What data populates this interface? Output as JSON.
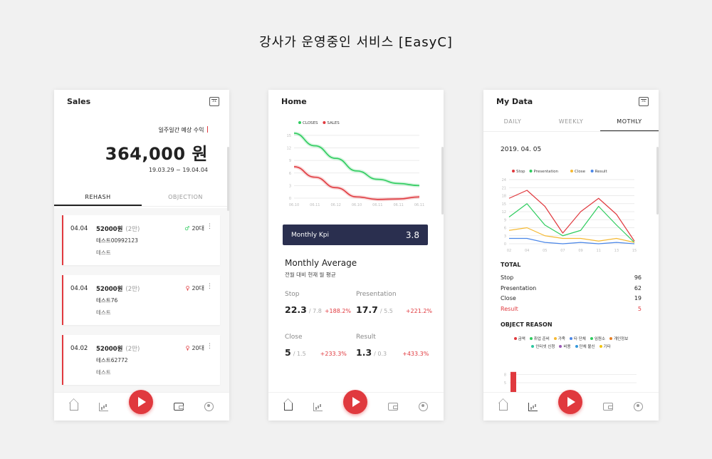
{
  "page_title": "강사가 운영중인 서비스 [EasyC]",
  "colors": {
    "accent": "#e0393e",
    "navy": "#2a2f4f",
    "green": "#2ecc5e"
  },
  "nav": {
    "icons": [
      "home-icon",
      "chart-icon",
      "play-icon",
      "wallet-icon",
      "user-icon"
    ]
  },
  "sales": {
    "title": "Sales",
    "calendar_num": "31",
    "label": "일주일간 예상 수익",
    "amount": "364,000 원",
    "range": "19.03.29 ~ 19.04.04",
    "tabs": [
      "REHASH",
      "OBJECTION"
    ],
    "cards": [
      {
        "date": "04.04",
        "amount": "52000원",
        "sub": "(2만)",
        "gender": "♂",
        "age": "20대",
        "id": "테스트00992123",
        "note": "테스트"
      },
      {
        "date": "04.04",
        "amount": "52000원",
        "sub": "(2만)",
        "gender": "♀",
        "age": "20대",
        "id": "테스트76",
        "note": "테스트"
      },
      {
        "date": "04.02",
        "amount": "52000원",
        "sub": "(2만)",
        "gender": "♀",
        "age": "20대",
        "id": "테스트62772",
        "note": "테스트"
      }
    ]
  },
  "home": {
    "title": "Home",
    "kpi_label": "Monthly Kpi",
    "kpi_value": "3.8",
    "avg_title": "Monthly Average",
    "avg_sub": "전월 대비 현재 월 평균",
    "stats": [
      {
        "label": "Stop",
        "value": "22.3",
        "prev": "/ 7.8",
        "change": "+188.2%"
      },
      {
        "label": "Presentation",
        "value": "17.7",
        "prev": "/ 5.5",
        "change": "+221.2%"
      },
      {
        "label": "Close",
        "value": "5",
        "prev": "/ 1.5",
        "change": "+233.3%"
      },
      {
        "label": "Result",
        "value": "1.3",
        "prev": "/ 0.3",
        "change": "+433.3%"
      }
    ]
  },
  "mydata": {
    "title": "My Data",
    "tabs": [
      "DAILY",
      "WEEKLY",
      "MOTHLY"
    ],
    "date": "2019. 04. 05",
    "total_title": "TOTAL",
    "totals": [
      {
        "label": "Stop",
        "value": "96"
      },
      {
        "label": "Presentation",
        "value": "62"
      },
      {
        "label": "Close",
        "value": "19"
      },
      {
        "label": "Result",
        "value": "5"
      }
    ],
    "reason_title": "OBJECT REASON",
    "reasons": [
      {
        "label": "금액",
        "color": "#e0393e"
      },
      {
        "label": "취업 준비",
        "color": "#2ecc5e"
      },
      {
        "label": "가족",
        "color": "#f5b933"
      },
      {
        "label": "타 단체",
        "color": "#4a86e8"
      },
      {
        "label": "임원소",
        "color": "#2ecc5e"
      },
      {
        "label": "개인정보",
        "color": "#e67e22"
      },
      {
        "label": "인터넷 신청",
        "color": "#2dc7a0"
      },
      {
        "label": "비용",
        "color": "#9b59b6"
      },
      {
        "label": "단체 불신",
        "color": "#3498db"
      },
      {
        "label": "기타",
        "color": "#f1c40f"
      }
    ]
  },
  "chart_data": [
    {
      "type": "line",
      "legend": [
        "CLOSES",
        "SALES"
      ],
      "x": [
        "06.10",
        "06.11",
        "06.12",
        "06.10",
        "06.11",
        "06.11",
        "06.11"
      ],
      "yticks": [
        0,
        3,
        6,
        9,
        12,
        15
      ],
      "ylim": [
        0,
        16
      ],
      "series": [
        {
          "name": "CLOSES",
          "color": "#2ecc5e",
          "values": [
            15.5,
            12.5,
            9.5,
            6.5,
            4.5,
            3.5,
            3.0
          ]
        },
        {
          "name": "SALES",
          "color": "#e0393e",
          "values": [
            7.5,
            5.0,
            2.5,
            0.3,
            -0.3,
            -0.2,
            0.3
          ]
        }
      ]
    },
    {
      "type": "line",
      "legend": [
        "Stop",
        "Presentation",
        "Close",
        "Result"
      ],
      "x": [
        "02",
        "04",
        "05",
        "07",
        "09",
        "11",
        "13",
        "15"
      ],
      "yticks": [
        0,
        3,
        6,
        9,
        12,
        15,
        18,
        21,
        24
      ],
      "ylim": [
        0,
        24
      ],
      "series": [
        {
          "name": "Stop",
          "color": "#e0393e",
          "values": [
            17,
            20,
            14,
            4,
            12,
            17,
            11,
            1
          ]
        },
        {
          "name": "Presentation",
          "color": "#2ecc5e",
          "values": [
            10,
            15,
            7,
            3,
            5,
            14,
            7,
            0.5
          ]
        },
        {
          "name": "Close",
          "color": "#f5b933",
          "values": [
            5,
            6,
            3,
            2,
            2,
            1,
            2,
            0.5
          ]
        },
        {
          "name": "Result",
          "color": "#4a86e8",
          "values": [
            2,
            2,
            0.5,
            0,
            0.5,
            0,
            0.5,
            0
          ]
        }
      ]
    },
    {
      "type": "bar",
      "yticks": [
        5,
        8
      ],
      "values": [
        9
      ]
    }
  ]
}
